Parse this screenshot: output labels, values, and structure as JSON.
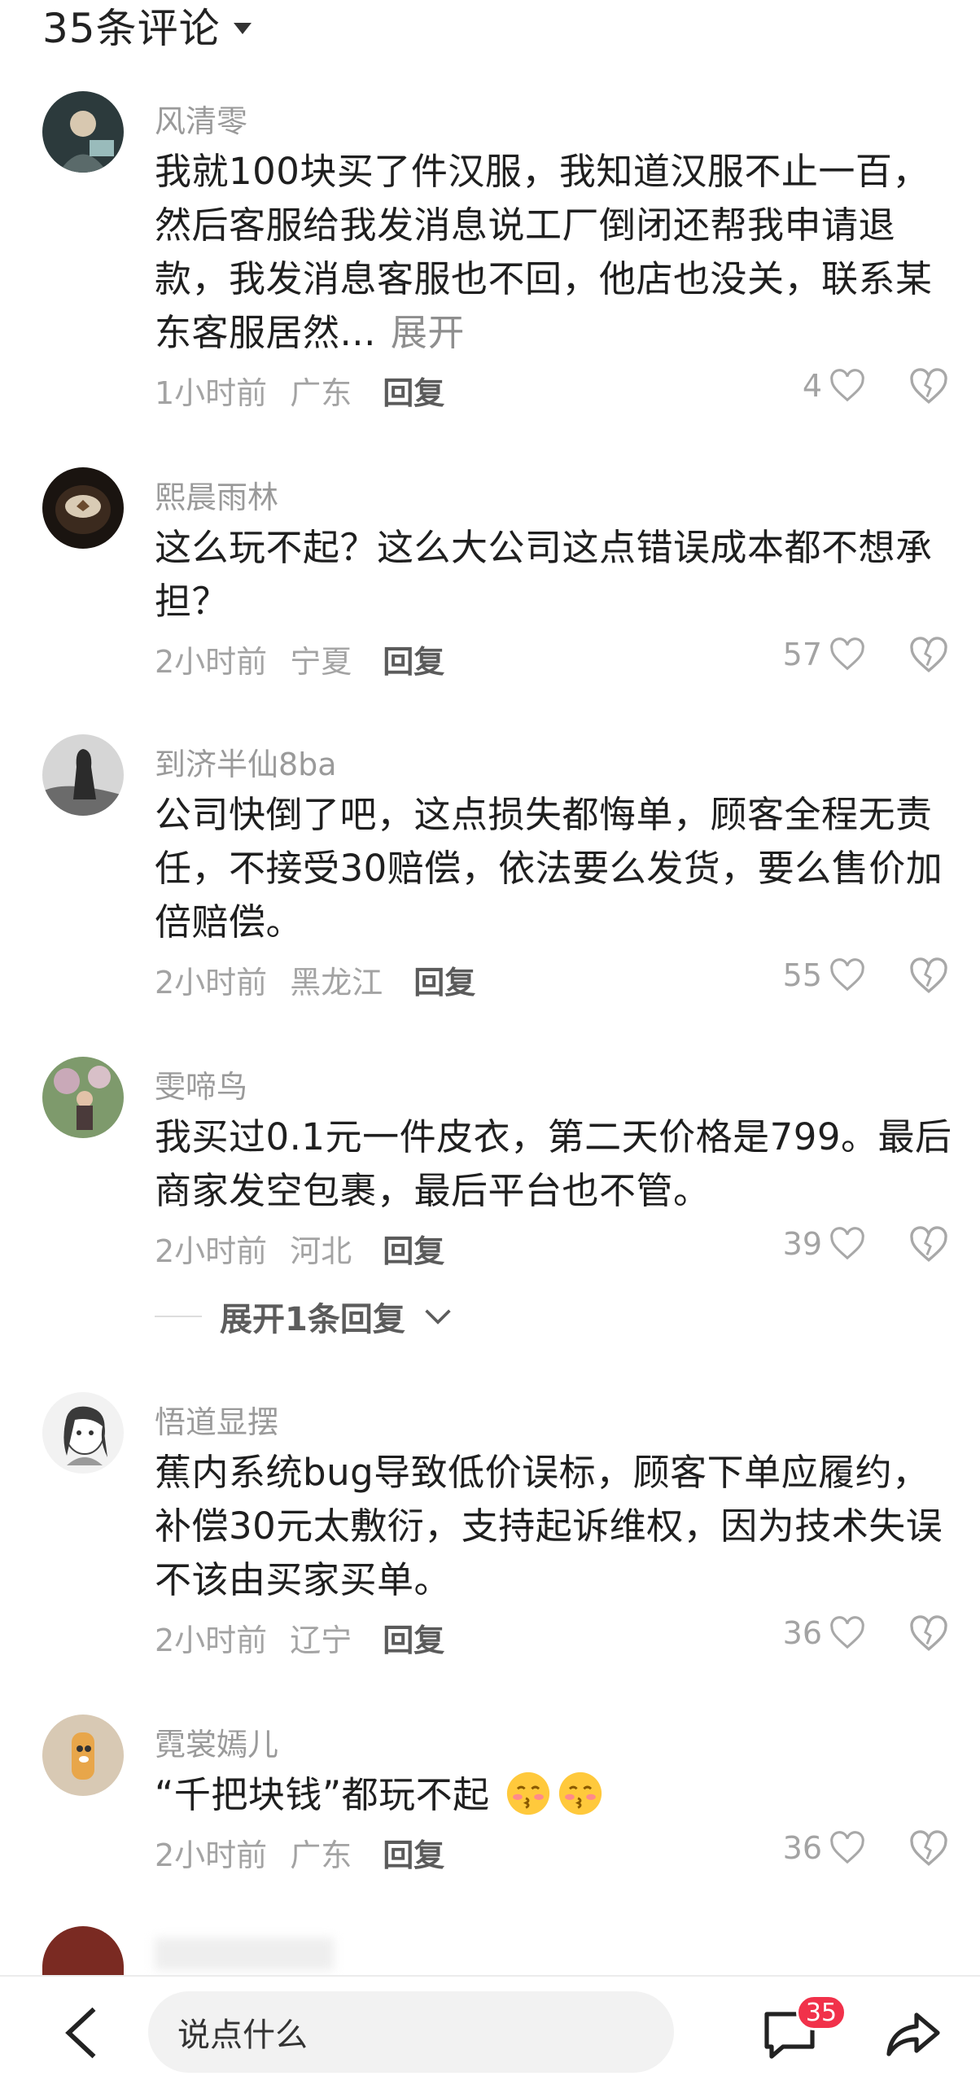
{
  "header": {
    "title": "35条评论"
  },
  "comments": [
    {
      "user": "风清零",
      "text": "我就100块买了件汉服，我知道汉服不止一百，然后客服给我发消息说工厂倒闭还帮我申请退款，我发消息客服也不回，他店也没关，联系某东客服居然...",
      "expand": "展开",
      "time": "1小时前",
      "location": "广东",
      "reply": "回复",
      "likes": "4"
    },
    {
      "user": "熙晨雨林",
      "text": "这么玩不起？这么大公司这点错误成本都不想承担？",
      "time": "2小时前",
      "location": "宁夏",
      "reply": "回复",
      "likes": "57"
    },
    {
      "user": "到济半仙8ba",
      "text": "公司快倒了吧，这点损失都悔单，顾客全程无责任，不接受30赔偿，依法要么发货，要么售价加倍赔偿。",
      "time": "2小时前",
      "location": "黑龙江",
      "reply": "回复",
      "likes": "55"
    },
    {
      "user": "雯啼鸟",
      "text": "我买过0.1元一件皮衣，第二天价格是799。最后商家发空包裹，最后平台也不管。",
      "time": "2小时前",
      "location": "河北",
      "reply": "回复",
      "likes": "39"
    },
    {
      "user": "悟道显摆",
      "text": "蕉内系统bug导致低价误标，顾客下单应履约，补偿30元太敷衍，支持起诉维权，因为技术失误不该由买家买单。",
      "time": "2小时前",
      "location": "辽宁",
      "reply": "回复",
      "likes": "36"
    },
    {
      "user": "霓裳嫣儿",
      "text": "“千把块钱”都玩不起",
      "time": "2小时前",
      "location": "广东",
      "reply": "回复",
      "likes": "36"
    }
  ],
  "expand_replies": {
    "label": "展开1条回复"
  },
  "bottom_bar": {
    "input_placeholder": "说点什么",
    "comment_count": "35"
  },
  "colors": {
    "badge": "#f1314a",
    "meta_text": "#a3a3a3",
    "username": "#9a9a9a"
  }
}
